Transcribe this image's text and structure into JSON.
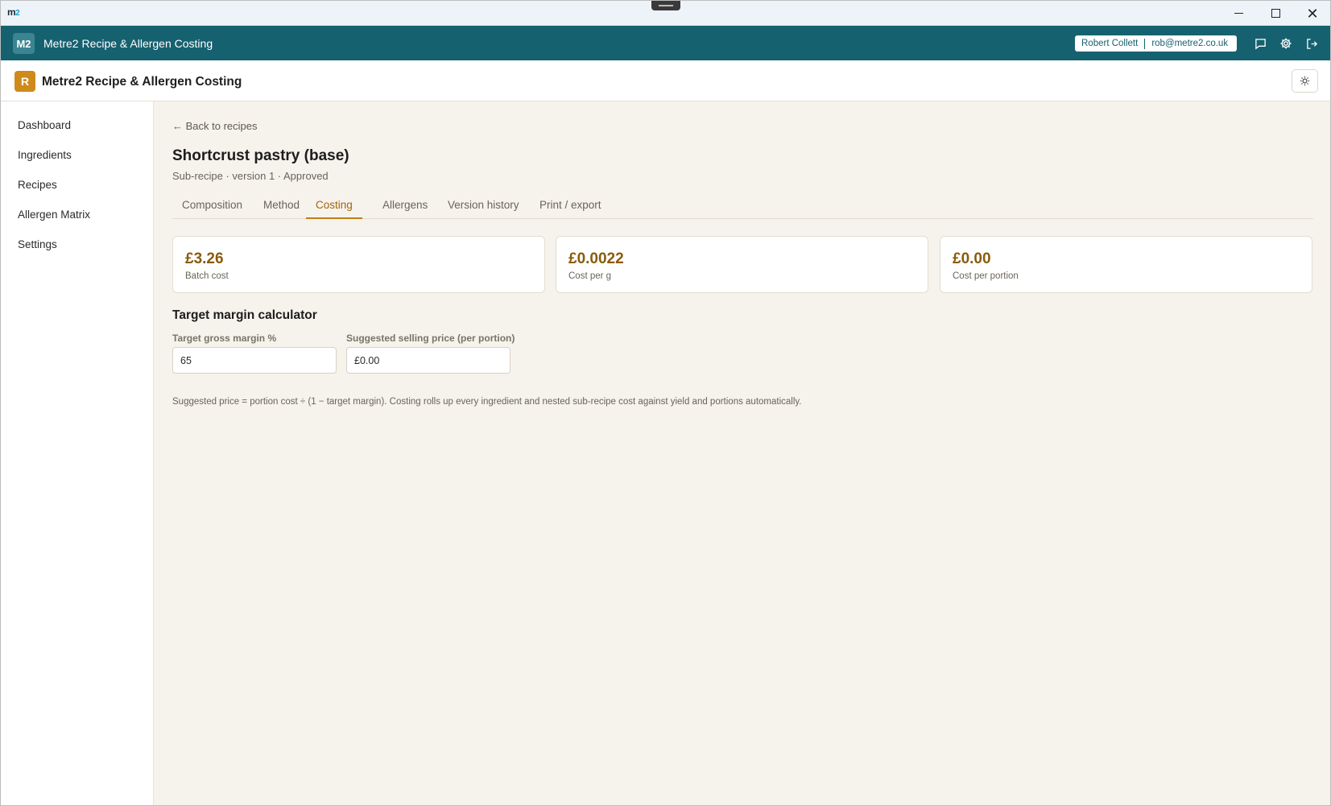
{
  "os": {
    "logo_m": "m",
    "logo_2": "2"
  },
  "header": {
    "badge": "M2",
    "title": "Metre2 Recipe & Allergen Costing",
    "user_name": "Robert Collett",
    "user_email": "rob@metre2.co.uk"
  },
  "subheader": {
    "badge": "R",
    "title": "Metre2 Recipe & Allergen Costing"
  },
  "sidebar": {
    "items": [
      {
        "label": "Dashboard"
      },
      {
        "label": "Ingredients"
      },
      {
        "label": "Recipes"
      },
      {
        "label": "Allergen Matrix"
      },
      {
        "label": "Settings"
      }
    ]
  },
  "page": {
    "back_link": "← Back to recipes",
    "title": "Shortcrust pastry (base)",
    "subtitle": "Sub-recipe · version 1 · Approved",
    "tabs": [
      {
        "label": "Composition"
      },
      {
        "label": "Method"
      },
      {
        "label": "Costing"
      },
      {
        "label": "Allergens"
      },
      {
        "label": "Version history"
      },
      {
        "label": "Print / export"
      }
    ],
    "active_tab": "Costing",
    "stats": [
      {
        "value": "£3.26",
        "label": "Batch cost"
      },
      {
        "value": "£0.0022",
        "label": "Cost per g"
      },
      {
        "value": "£0.00",
        "label": "Cost per portion"
      }
    ],
    "calculator": {
      "title": "Target margin calculator",
      "margin_label": "Target gross margin %",
      "margin_value": "65",
      "price_label": "Suggested selling price (per portion)",
      "price_value": "£0.00"
    },
    "note": "Suggested price = portion cost ÷ (1 − target margin). Costing rolls up every ingredient and nested sub-recipe cost against yield and portions automatically."
  },
  "colors": {
    "header_bg": "#16616f",
    "accent": "#c07d16",
    "stat_value": "#8a5b0d",
    "main_bg": "#f6f2ec"
  }
}
